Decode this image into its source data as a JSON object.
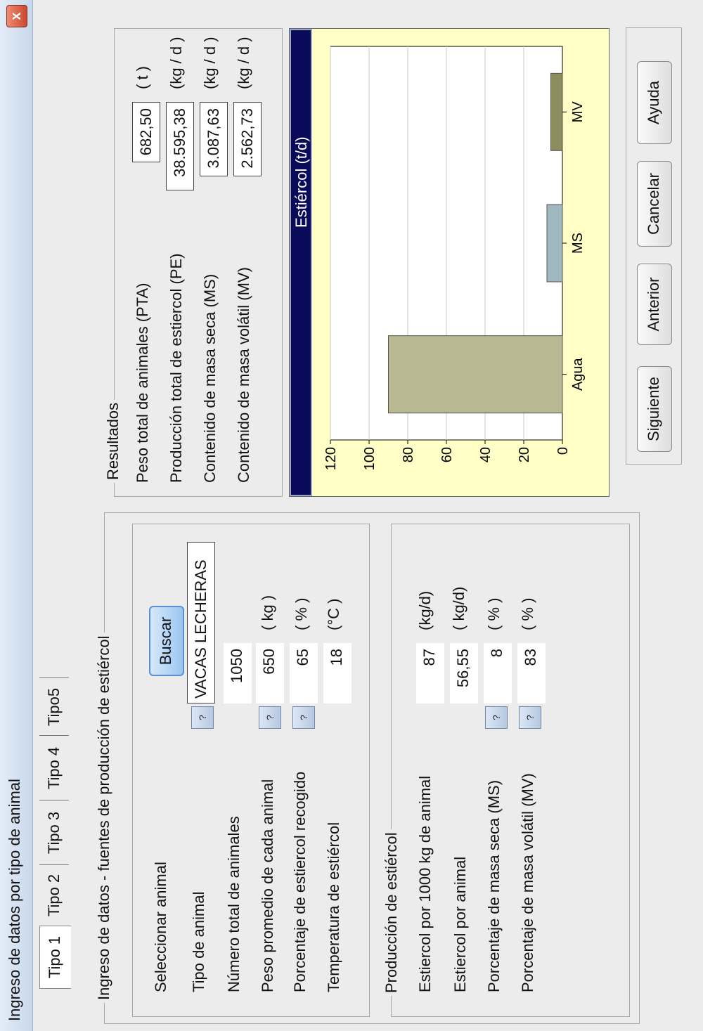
{
  "window": {
    "title": "Ingreso de datos por tipo de animal",
    "close_label": "x"
  },
  "tabs": [
    {
      "label": "Tipo 1"
    },
    {
      "label": "Tipo 2"
    },
    {
      "label": "Tipo 3"
    },
    {
      "label": "Tipo 4"
    },
    {
      "label": "Tipo5"
    }
  ],
  "input_panel": {
    "legend": "Ingreso de datos - fuentes de producción de estiércol",
    "select_animal_label": "Seleccionar animal",
    "search_button": "Buscar",
    "animal_type_label": "Tipo de animal",
    "animal_type_value": "VACAS LECHERAS",
    "help_glyph": "?",
    "count_label": "Número total de animales",
    "count_value": "1050",
    "weight_label": "Peso promedio de cada animal",
    "weight_value": "650",
    "weight_unit": "( kg )",
    "collected_label": "Porcentaje de estiercol recogido",
    "collected_value": "65",
    "collected_unit": "( % )",
    "temp_label": "Temperatura de estiércol",
    "temp_value": "18",
    "temp_unit": "(°C )"
  },
  "production_panel": {
    "legend": "Producción de estiércol",
    "per1000_label": "Estiercol por 1000 kg de animal",
    "per1000_value": "87",
    "per1000_unit": "(kg/d)",
    "per_animal_label": "Estiercol por animal",
    "per_animal_value": "56,55",
    "per_animal_unit": "( kg/d)",
    "ms_label": "Porcentaje de masa seca (MS)",
    "ms_value": "8",
    "ms_unit": "( % )",
    "mv_label": "Porcentaje de masa volátil (MV)",
    "mv_value": "83",
    "mv_unit": "( % )"
  },
  "results_panel": {
    "legend": "Resultados",
    "pta_label": "Peso total de animales (PTA)",
    "pta_value": "682,50",
    "pta_unit": "( t )",
    "pe_label": "Producción total de estiercol (PE)",
    "pe_value": "38.595,38",
    "pe_unit": "(kg / d )",
    "ms_label": "Contenido de masa seca (MS)",
    "ms_value": "3.087,63",
    "ms_unit": "(kg / d )",
    "mv_label": "Contenido de masa volátil (MV)",
    "mv_value": "2.562,73",
    "mv_unit": "(kg / d )"
  },
  "buttons": {
    "next": "Siguiente",
    "previous": "Anterior",
    "cancel": "Cancelar",
    "help": "Ayuda"
  },
  "colors": {
    "agua": "#b8b892",
    "ms": "#9fb8c0",
    "mv": "#8c8c5c",
    "plot_bg": "#ffffc6",
    "header_bg": "#0a0a5a"
  },
  "chart_data": {
    "type": "bar",
    "title": "Estiércol (t/d)",
    "categories": [
      "Agua",
      "MS",
      "MV"
    ],
    "values": [
      90,
      8,
      6
    ],
    "ylim": [
      0,
      120
    ],
    "yticks": [
      0,
      20,
      40,
      60,
      80,
      100,
      120
    ],
    "grid": true
  }
}
